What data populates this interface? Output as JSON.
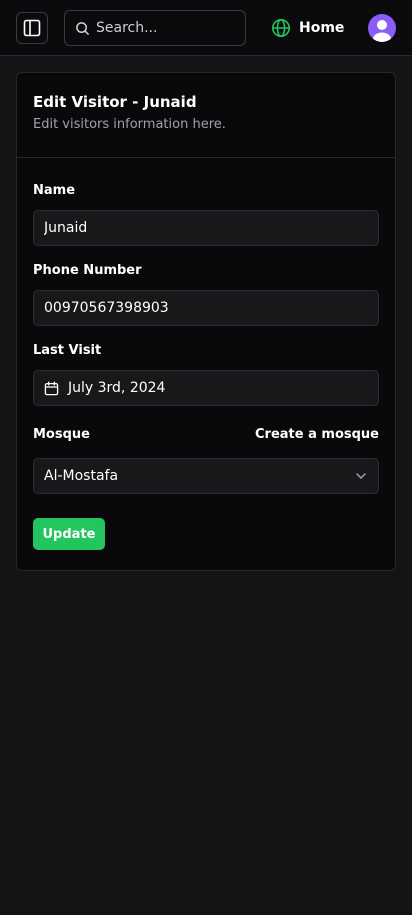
{
  "topbar": {
    "search_placeholder": "Search...",
    "home_label": "Home"
  },
  "card": {
    "title": "Edit Visitor - Junaid",
    "description": "Edit visitors information here."
  },
  "form": {
    "name_label": "Name",
    "name_value": "Junaid",
    "phone_label": "Phone Number",
    "phone_value": "00970567398903",
    "last_visit_label": "Last Visit",
    "last_visit_value": "July 3rd, 2024",
    "mosque_label": "Mosque",
    "create_mosque_link": "Create a mosque",
    "mosque_selected": "Al-Mostafa",
    "submit_label": "Update"
  },
  "colors": {
    "background": "#141416",
    "card": "#09090b",
    "accent_green": "#22c55e",
    "avatar": "#8b5cf6"
  },
  "icons": [
    "sidebar-toggle-icon",
    "search-icon",
    "globe-icon",
    "user-icon",
    "calendar-icon",
    "chevron-down-icon"
  ]
}
